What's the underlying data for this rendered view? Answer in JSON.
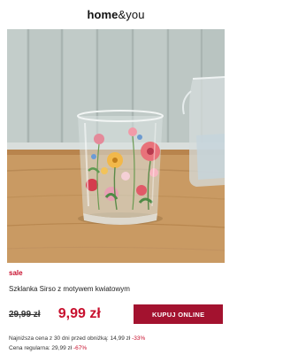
{
  "brand": {
    "logo_bold": "home",
    "logo_light": "&you"
  },
  "product": {
    "badge": "sale",
    "name": "Szklanka Sirso z motywem kwiatowym",
    "old_price": "29,99 zł",
    "new_price": "9,99 zł",
    "buy_label": "KUPUJ ONLINE",
    "lowest_price_label": "Najniższa cena z 30 dni przed obniżką: 14,99 zł",
    "lowest_price_discount": "-33%",
    "regular_price_label": "Cena regularna: 29,99 zł",
    "regular_price_discount": "-67%"
  },
  "colors": {
    "accent": "#c8102e",
    "button": "#a3122f"
  }
}
